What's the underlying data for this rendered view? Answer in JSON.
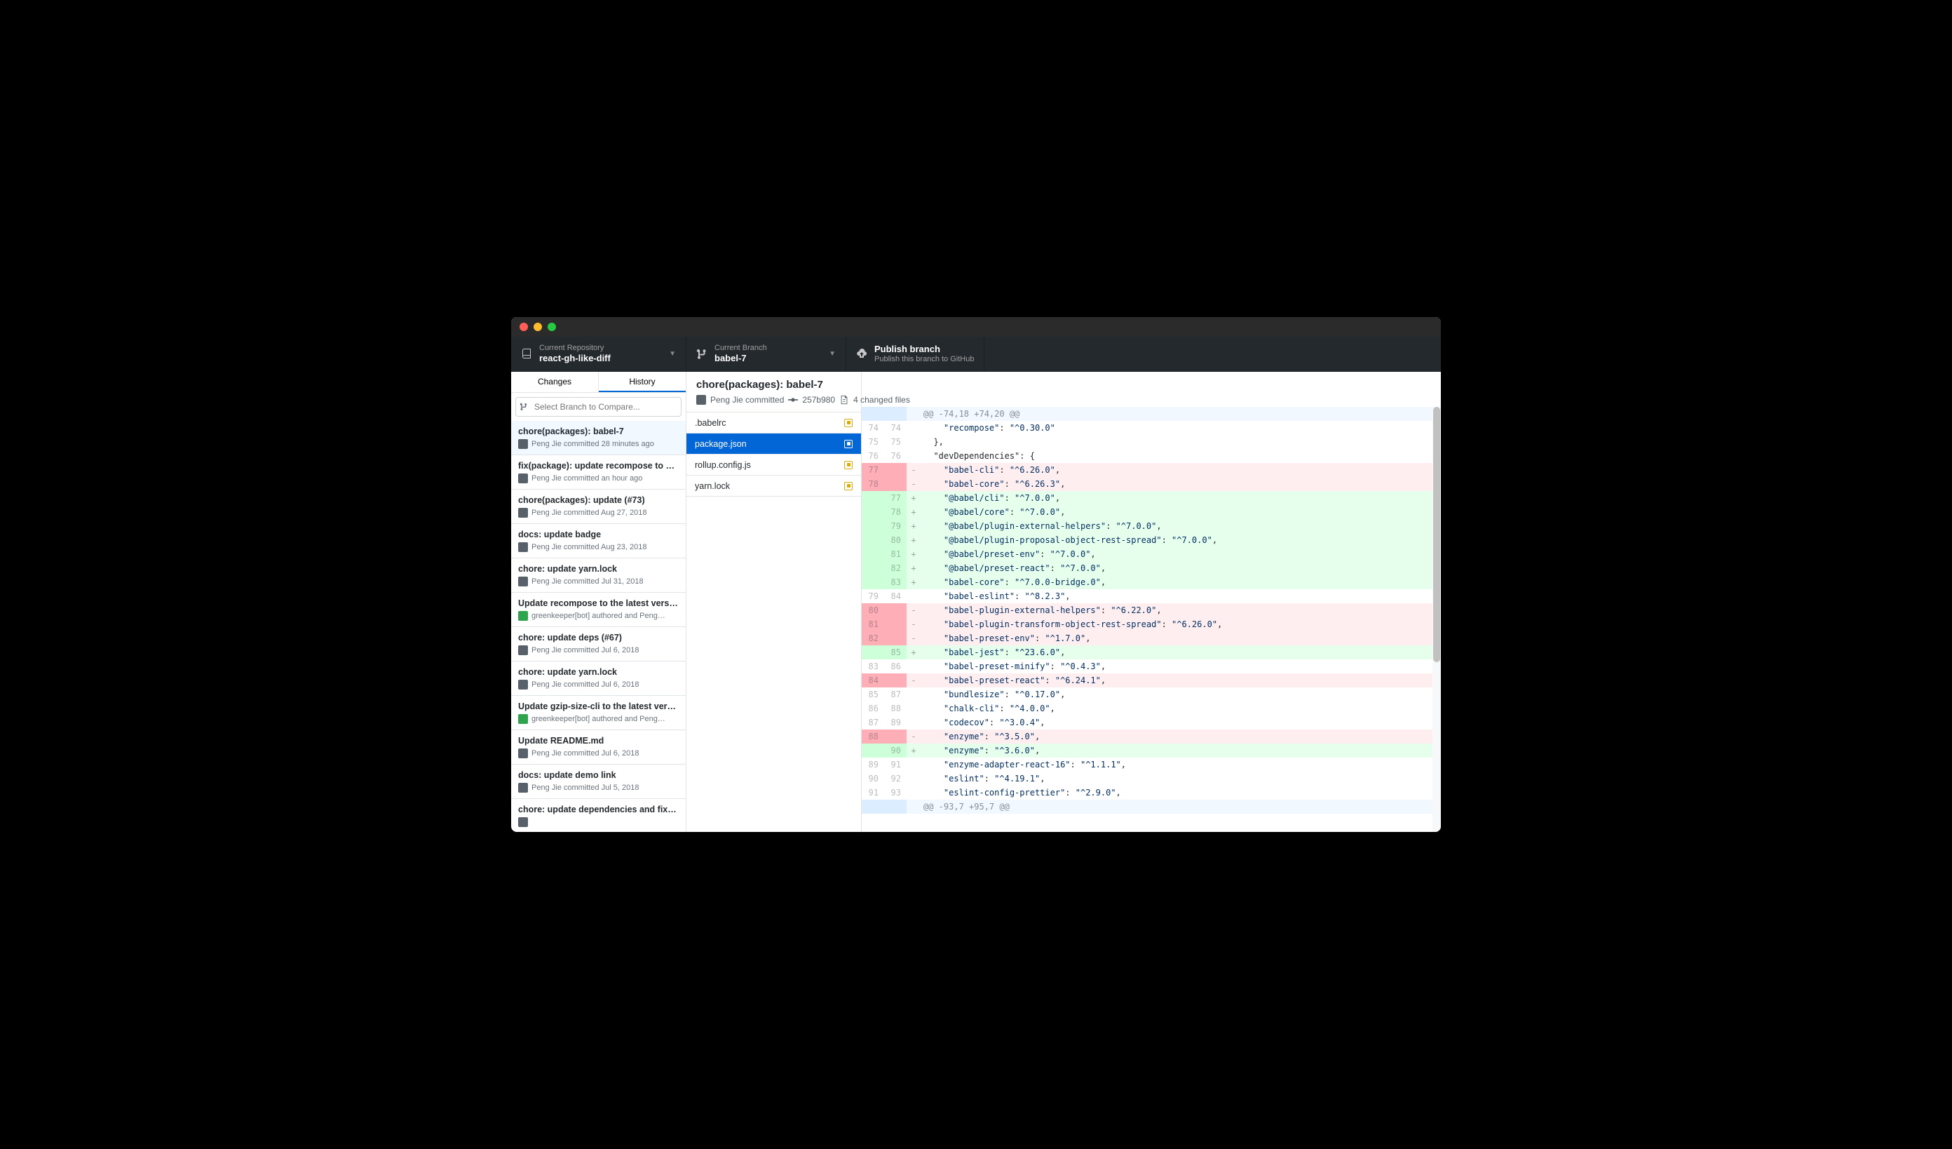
{
  "toolbar": {
    "repo_label": "Current Repository",
    "repo_value": "react-gh-like-diff",
    "branch_label": "Current Branch",
    "branch_value": "babel-7",
    "publish_title": "Publish branch",
    "publish_sub": "Publish this branch to GitHub"
  },
  "tabs": {
    "changes": "Changes",
    "history": "History"
  },
  "compare_placeholder": "Select Branch to Compare...",
  "commits": [
    {
      "title": "chore(packages): babel-7",
      "author": "Peng Jie committed",
      "time": "28 minutes ago",
      "avatar": "user",
      "selected": true
    },
    {
      "title": "fix(package): update recompose to v…",
      "author": "Peng Jie committed",
      "time": "an hour ago",
      "avatar": "user"
    },
    {
      "title": "chore(packages): update (#73)",
      "author": "Peng Jie committed",
      "time": "Aug 27, 2018",
      "avatar": "user"
    },
    {
      "title": "docs: update badge",
      "author": "Peng Jie committed",
      "time": "Aug 23, 2018",
      "avatar": "user"
    },
    {
      "title": "chore: update yarn.lock",
      "author": "Peng Jie committed",
      "time": "Jul 31, 2018",
      "avatar": "user"
    },
    {
      "title": "Update recompose to the latest versi…",
      "author": "greenkeeper[bot] authored and Peng…",
      "time": "",
      "avatar": "bot"
    },
    {
      "title": "chore: update deps (#67)",
      "author": "Peng Jie committed",
      "time": "Jul 6, 2018",
      "avatar": "user"
    },
    {
      "title": "chore: update yarn.lock",
      "author": "Peng Jie committed",
      "time": "Jul 6, 2018",
      "avatar": "user"
    },
    {
      "title": "Update gzip-size-cli to the latest ver…",
      "author": "greenkeeper[bot] authored and Peng…",
      "time": "",
      "avatar": "bot"
    },
    {
      "title": "Update README.md",
      "author": "Peng Jie committed",
      "time": "Jul 6, 2018",
      "avatar": "user"
    },
    {
      "title": "docs: update demo link",
      "author": "Peng Jie committed",
      "time": "Jul 5, 2018",
      "avatar": "user"
    },
    {
      "title": "chore: update dependencies and fix l…",
      "author": "",
      "time": "",
      "avatar": "user"
    }
  ],
  "detail": {
    "title": "chore(packages): babel-7",
    "author": "Peng Jie committed",
    "sha": "257b980",
    "files_count": "4 changed files"
  },
  "files": [
    {
      "name": ".babelrc",
      "selected": false
    },
    {
      "name": "package.json",
      "selected": true
    },
    {
      "name": "rollup.config.js",
      "selected": false
    },
    {
      "name": "yarn.lock",
      "selected": false
    }
  ],
  "diff": [
    {
      "t": "hunk",
      "old": "",
      "new": "",
      "m": "",
      "c": "@@ -74,18 +74,20 @@"
    },
    {
      "t": "ctx",
      "old": "74",
      "new": "74",
      "m": " ",
      "k": "    \"recompose\"",
      "v": "\"^0.30.0\""
    },
    {
      "t": "ctx",
      "old": "75",
      "new": "75",
      "m": " ",
      "c": "  },"
    },
    {
      "t": "ctx",
      "old": "76",
      "new": "76",
      "m": " ",
      "c": "  \"devDependencies\": {"
    },
    {
      "t": "del",
      "old": "77",
      "new": "",
      "m": "-",
      "k": "    \"babel-cli\"",
      "v": "\"^6.26.0\"",
      "comma": ","
    },
    {
      "t": "del",
      "old": "78",
      "new": "",
      "m": "-",
      "k": "    \"babel-core\"",
      "v": "\"^6.26.3\"",
      "comma": ","
    },
    {
      "t": "add",
      "old": "",
      "new": "77",
      "m": "+",
      "k": "    \"@babel/cli\"",
      "v": "\"^7.0.0\"",
      "comma": ","
    },
    {
      "t": "add",
      "old": "",
      "new": "78",
      "m": "+",
      "k": "    \"@babel/core\"",
      "v": "\"^7.0.0\"",
      "comma": ","
    },
    {
      "t": "add",
      "old": "",
      "new": "79",
      "m": "+",
      "k": "    \"@babel/plugin-external-helpers\"",
      "v": "\"^7.0.0\"",
      "comma": ","
    },
    {
      "t": "add",
      "old": "",
      "new": "80",
      "m": "+",
      "k": "    \"@babel/plugin-proposal-object-rest-spread\"",
      "v": "\"^7.0.0\"",
      "comma": ","
    },
    {
      "t": "add",
      "old": "",
      "new": "81",
      "m": "+",
      "k": "    \"@babel/preset-env\"",
      "v": "\"^7.0.0\"",
      "comma": ","
    },
    {
      "t": "add",
      "old": "",
      "new": "82",
      "m": "+",
      "k": "    \"@babel/preset-react\"",
      "v": "\"^7.0.0\"",
      "comma": ","
    },
    {
      "t": "add",
      "old": "",
      "new": "83",
      "m": "+",
      "k": "    \"babel-core\"",
      "v": "\"^7.0.0-bridge.0\"",
      "comma": ","
    },
    {
      "t": "ctx",
      "old": "79",
      "new": "84",
      "m": " ",
      "k": "    \"babel-eslint\"",
      "v": "\"^8.2.3\"",
      "comma": ","
    },
    {
      "t": "del",
      "old": "80",
      "new": "",
      "m": "-",
      "k": "    \"babel-plugin-external-helpers\"",
      "v": "\"^6.22.0\"",
      "comma": ","
    },
    {
      "t": "del",
      "old": "81",
      "new": "",
      "m": "-",
      "k": "    \"babel-plugin-transform-object-rest-spread\"",
      "v": "\"^6.26.0\"",
      "comma": ","
    },
    {
      "t": "del",
      "old": "82",
      "new": "",
      "m": "-",
      "k": "    \"babel-preset-env\"",
      "v": "\"^1.7.0\"",
      "comma": ","
    },
    {
      "t": "add",
      "old": "",
      "new": "85",
      "m": "+",
      "k": "    \"babel-jest\"",
      "v": "\"^23.6.0\"",
      "comma": ","
    },
    {
      "t": "ctx",
      "old": "83",
      "new": "86",
      "m": " ",
      "k": "    \"babel-preset-minify\"",
      "v": "\"^0.4.3\"",
      "comma": ","
    },
    {
      "t": "del",
      "old": "84",
      "new": "",
      "m": "-",
      "k": "    \"babel-preset-react\"",
      "v": "\"^6.24.1\"",
      "comma": ","
    },
    {
      "t": "ctx",
      "old": "85",
      "new": "87",
      "m": " ",
      "k": "    \"bundlesize\"",
      "v": "\"^0.17.0\"",
      "comma": ","
    },
    {
      "t": "ctx",
      "old": "86",
      "new": "88",
      "m": " ",
      "k": "    \"chalk-cli\"",
      "v": "\"^4.0.0\"",
      "comma": ","
    },
    {
      "t": "ctx",
      "old": "87",
      "new": "89",
      "m": " ",
      "k": "    \"codecov\"",
      "v": "\"^3.0.4\"",
      "comma": ","
    },
    {
      "t": "del",
      "old": "88",
      "new": "",
      "m": "-",
      "k": "    \"enzyme\"",
      "v": "\"^3.5.0\"",
      "comma": ","
    },
    {
      "t": "add",
      "old": "",
      "new": "90",
      "m": "+",
      "k": "    \"enzyme\"",
      "v": "\"^3.6.0\"",
      "comma": ","
    },
    {
      "t": "ctx",
      "old": "89",
      "new": "91",
      "m": " ",
      "k": "    \"enzyme-adapter-react-16\"",
      "v": "\"^1.1.1\"",
      "comma": ","
    },
    {
      "t": "ctx",
      "old": "90",
      "new": "92",
      "m": " ",
      "k": "    \"eslint\"",
      "v": "\"^4.19.1\"",
      "comma": ","
    },
    {
      "t": "ctx",
      "old": "91",
      "new": "93",
      "m": " ",
      "k": "    \"eslint-config-prettier\"",
      "v": "\"^2.9.0\"",
      "comma": ","
    },
    {
      "t": "hunk",
      "old": "",
      "new": "",
      "m": "",
      "c": "@@ -93,7 +95,7 @@"
    }
  ]
}
